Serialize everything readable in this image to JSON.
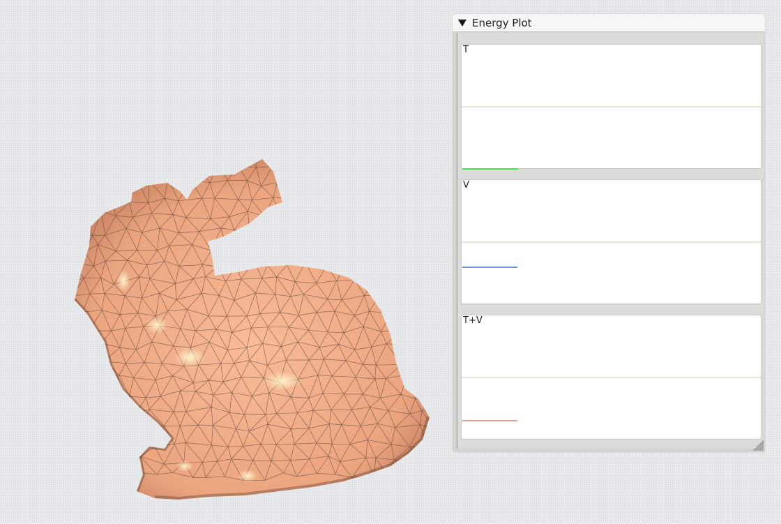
{
  "viewport": {
    "model": "bunny-mesh",
    "mesh_color": "#f4b38f",
    "wire_color": "#6b4a3a"
  },
  "energy_panel": {
    "title": "Energy Plot",
    "collapse_icon": "triangle-down-icon",
    "plots": [
      {
        "label": "T",
        "color": "#3dd63d"
      },
      {
        "label": "V",
        "color": "#6f95d8"
      },
      {
        "label": "T+V",
        "color": "#dda79a"
      }
    ]
  }
}
